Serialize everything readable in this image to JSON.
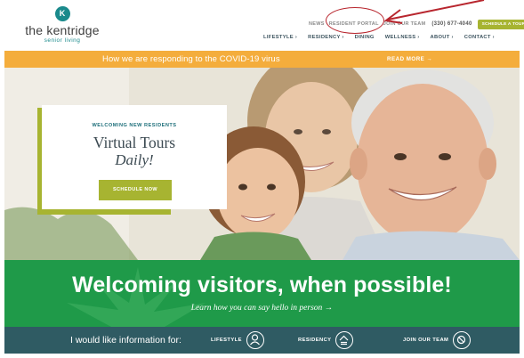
{
  "brand": {
    "mark": "K",
    "name": "the kentridge",
    "tagline": "senior living",
    "teal": "#1a8a8c"
  },
  "util_nav": {
    "items": [
      "NEWS",
      "RESIDENT PORTAL",
      "JOIN OUR TEAM"
    ],
    "phone": "(330) 677-4040",
    "tour_button": "SCHEDULE A TOUR"
  },
  "main_nav": {
    "items": [
      "LIFESTYLE ›",
      "RESIDENCY ›",
      "DINING",
      "WELLNESS ›",
      "ABOUT ›",
      "CONTACT ›"
    ]
  },
  "covid_banner": {
    "text": "How we are responding to the COVID-19 virus",
    "link": "READ MORE →",
    "color": "#f4ad3c"
  },
  "hero_promo": {
    "eyebrow": "WELCOMING NEW RESIDENTS",
    "title": "Virtual Tours",
    "subtitle": "Daily!",
    "button": "SCHEDULE NOW",
    "accent": "#a7b431"
  },
  "visitors_band": {
    "title": "Welcoming visitors, when possible!",
    "subtitle": "Learn how you can say hello in person  →",
    "color": "#1f9a49"
  },
  "info_bar": {
    "label": "I would like information for:",
    "options": [
      {
        "label": "LIFESTYLE",
        "icon": "person-icon"
      },
      {
        "label": "RESIDENCY",
        "icon": "residency-icon"
      },
      {
        "label": "JOIN OUR TEAM",
        "icon": "team-icon"
      }
    ],
    "color": "#2f5b63"
  },
  "annotation": {
    "color": "#b8262e",
    "target": "RESIDENT PORTAL"
  }
}
